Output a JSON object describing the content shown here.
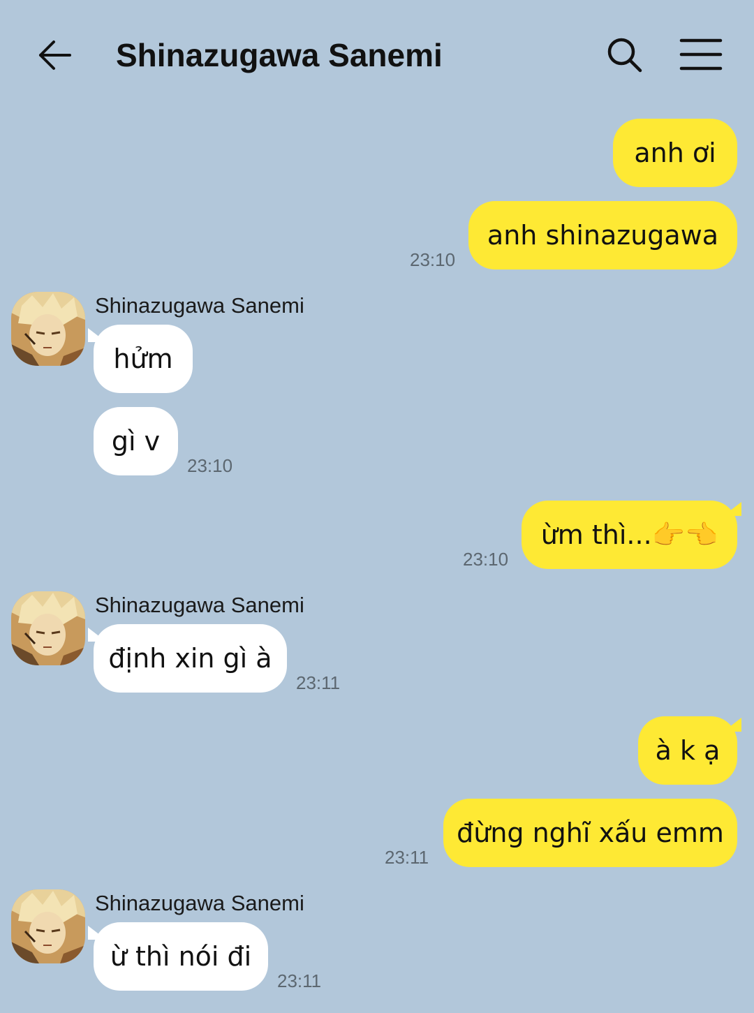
{
  "header": {
    "title": "Shinazugawa Sanemi"
  },
  "colors": {
    "background": "#b2c7da",
    "sent_bubble": "#fee934",
    "received_bubble": "#ffffff"
  },
  "icons": {
    "back": "arrow-left-icon",
    "search": "search-icon",
    "menu": "hamburger-menu-icon"
  },
  "messages": [
    {
      "side": "sent",
      "text": "anh ơi",
      "time": ""
    },
    {
      "side": "sent",
      "text": "anh shinazugawa",
      "time": "23:10"
    },
    {
      "side": "received",
      "sender": "Shinazugawa Sanemi",
      "text": "hửm",
      "time": ""
    },
    {
      "side": "received",
      "text": "gì v",
      "time": "23:10"
    },
    {
      "side": "sent",
      "text": "ừm thì...👉👈",
      "time": "23:10"
    },
    {
      "side": "received",
      "sender": "Shinazugawa Sanemi",
      "text": "định xin gì à",
      "time": "23:11"
    },
    {
      "side": "sent",
      "text": "à k ạ",
      "time": ""
    },
    {
      "side": "sent",
      "text": "đừng nghĩ xấu emm",
      "time": "23:11"
    },
    {
      "side": "received",
      "sender": "Shinazugawa Sanemi",
      "text": "ừ thì nói đi",
      "time": "23:11"
    }
  ]
}
